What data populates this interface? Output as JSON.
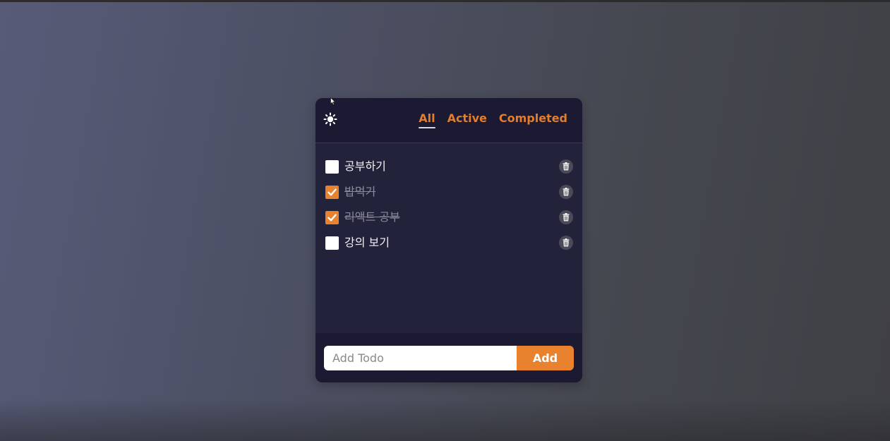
{
  "theme": {
    "icon": "sun-icon",
    "accent": "#e8822e",
    "card_background": "#22223a",
    "header_background": "#1b1a32"
  },
  "filters": [
    {
      "label": "All",
      "selected": true
    },
    {
      "label": "Active",
      "selected": false
    },
    {
      "label": "Completed",
      "selected": false
    }
  ],
  "todos": [
    {
      "text": "공부하기",
      "completed": false
    },
    {
      "text": "밥먹기",
      "completed": true
    },
    {
      "text": "리액트 공부",
      "completed": true
    },
    {
      "text": "강의 보기",
      "completed": false
    }
  ],
  "add_form": {
    "placeholder": "Add Todo",
    "value": "",
    "button_label": "Add"
  },
  "icons": {
    "delete": "trash-icon",
    "check": "checkmark-icon"
  }
}
